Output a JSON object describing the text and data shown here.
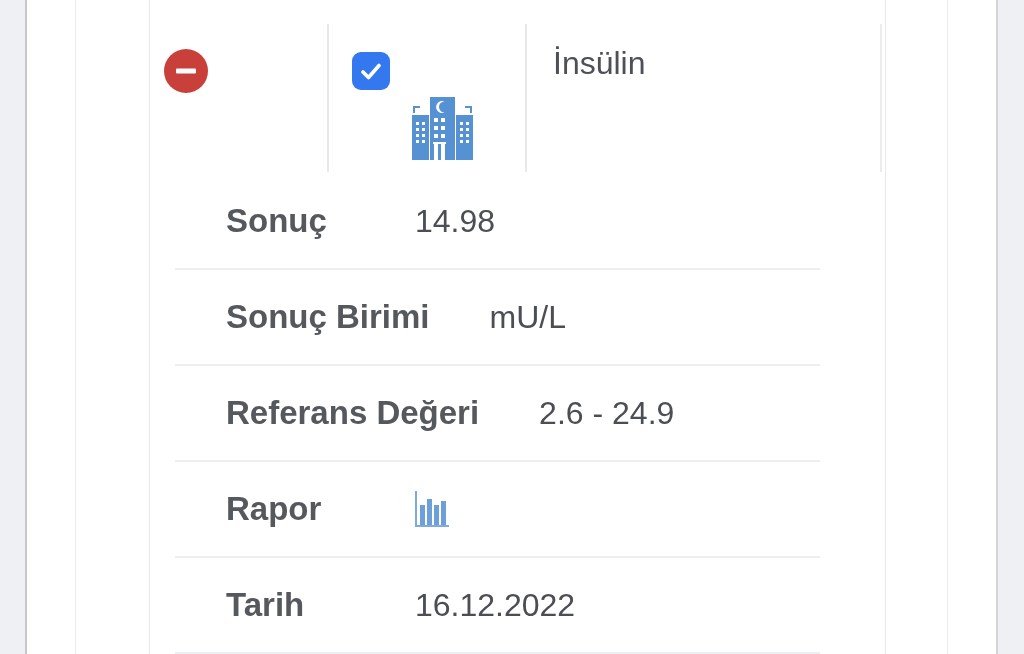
{
  "record": {
    "checked": true,
    "test_name": "İnsülin",
    "details": [
      {
        "kind": "text",
        "label": "Sonuç",
        "value": "14.98"
      },
      {
        "kind": "text",
        "label": "Sonuç Birimi",
        "value": "mU/L"
      },
      {
        "kind": "text",
        "label": "Referans Değeri",
        "value": "2.6 - 24.9"
      },
      {
        "kind": "report",
        "label": "Rapor"
      },
      {
        "kind": "text",
        "label": "Tarih",
        "value": "16.12.2022"
      }
    ]
  }
}
